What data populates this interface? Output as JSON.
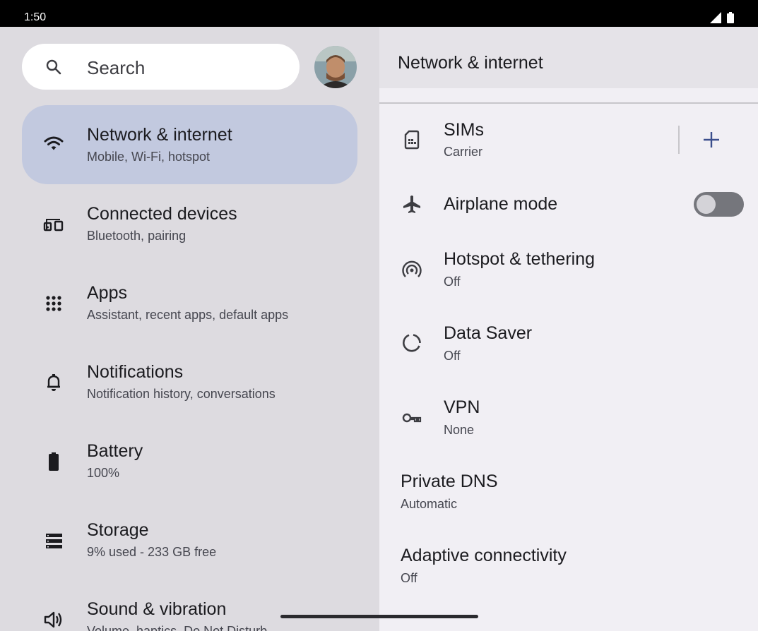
{
  "status_bar": {
    "time": "1:50",
    "signal_icon": "signal-icon",
    "battery_icon": "battery-icon"
  },
  "search": {
    "placeholder": "Search",
    "icon": "search-icon"
  },
  "avatar": {
    "icon": "avatar"
  },
  "nav": {
    "items": [
      {
        "title": "Network & internet",
        "subtitle": "Mobile, Wi‑Fi, hotspot",
        "icon": "wifi-icon",
        "selected": true
      },
      {
        "title": "Connected devices",
        "subtitle": "Bluetooth, pairing",
        "icon": "devices-icon",
        "selected": false
      },
      {
        "title": "Apps",
        "subtitle": "Assistant, recent apps, default apps",
        "icon": "apps-grid-icon",
        "selected": false
      },
      {
        "title": "Notifications",
        "subtitle": "Notification history, conversations",
        "icon": "bell-icon",
        "selected": false
      },
      {
        "title": "Battery",
        "subtitle": "100%",
        "icon": "battery-icon",
        "selected": false
      },
      {
        "title": "Storage",
        "subtitle": "9% used - 233 GB free",
        "icon": "storage-icon",
        "selected": false
      },
      {
        "title": "Sound & vibration",
        "subtitle": "Volume, haptics, Do Not Disturb",
        "icon": "speaker-icon",
        "selected": false
      }
    ]
  },
  "detail": {
    "title": "Network & internet",
    "rows": [
      {
        "title": "SIMs",
        "subtitle": "Carrier",
        "icon": "sim-card-icon"
      },
      {
        "title": "Airplane mode",
        "subtitle": "",
        "icon": "airplane-icon",
        "toggle": false
      },
      {
        "title": "Hotspot & tethering",
        "subtitle": "Off",
        "icon": "hotspot-icon"
      },
      {
        "title": "Data Saver",
        "subtitle": "Off",
        "icon": "data-saver-icon"
      },
      {
        "title": "VPN",
        "subtitle": "None",
        "icon": "vpn-key-icon"
      },
      {
        "title": "Private DNS",
        "subtitle": "Automatic"
      },
      {
        "title": "Adaptive connectivity",
        "subtitle": "Off"
      }
    ],
    "add_sim_icon": "plus-icon"
  },
  "colors": {
    "selected_bg": "#c2c9df",
    "left_bg": "#dddbe0",
    "right_bg": "#f1eff4",
    "accent": "#3b4e8c"
  }
}
